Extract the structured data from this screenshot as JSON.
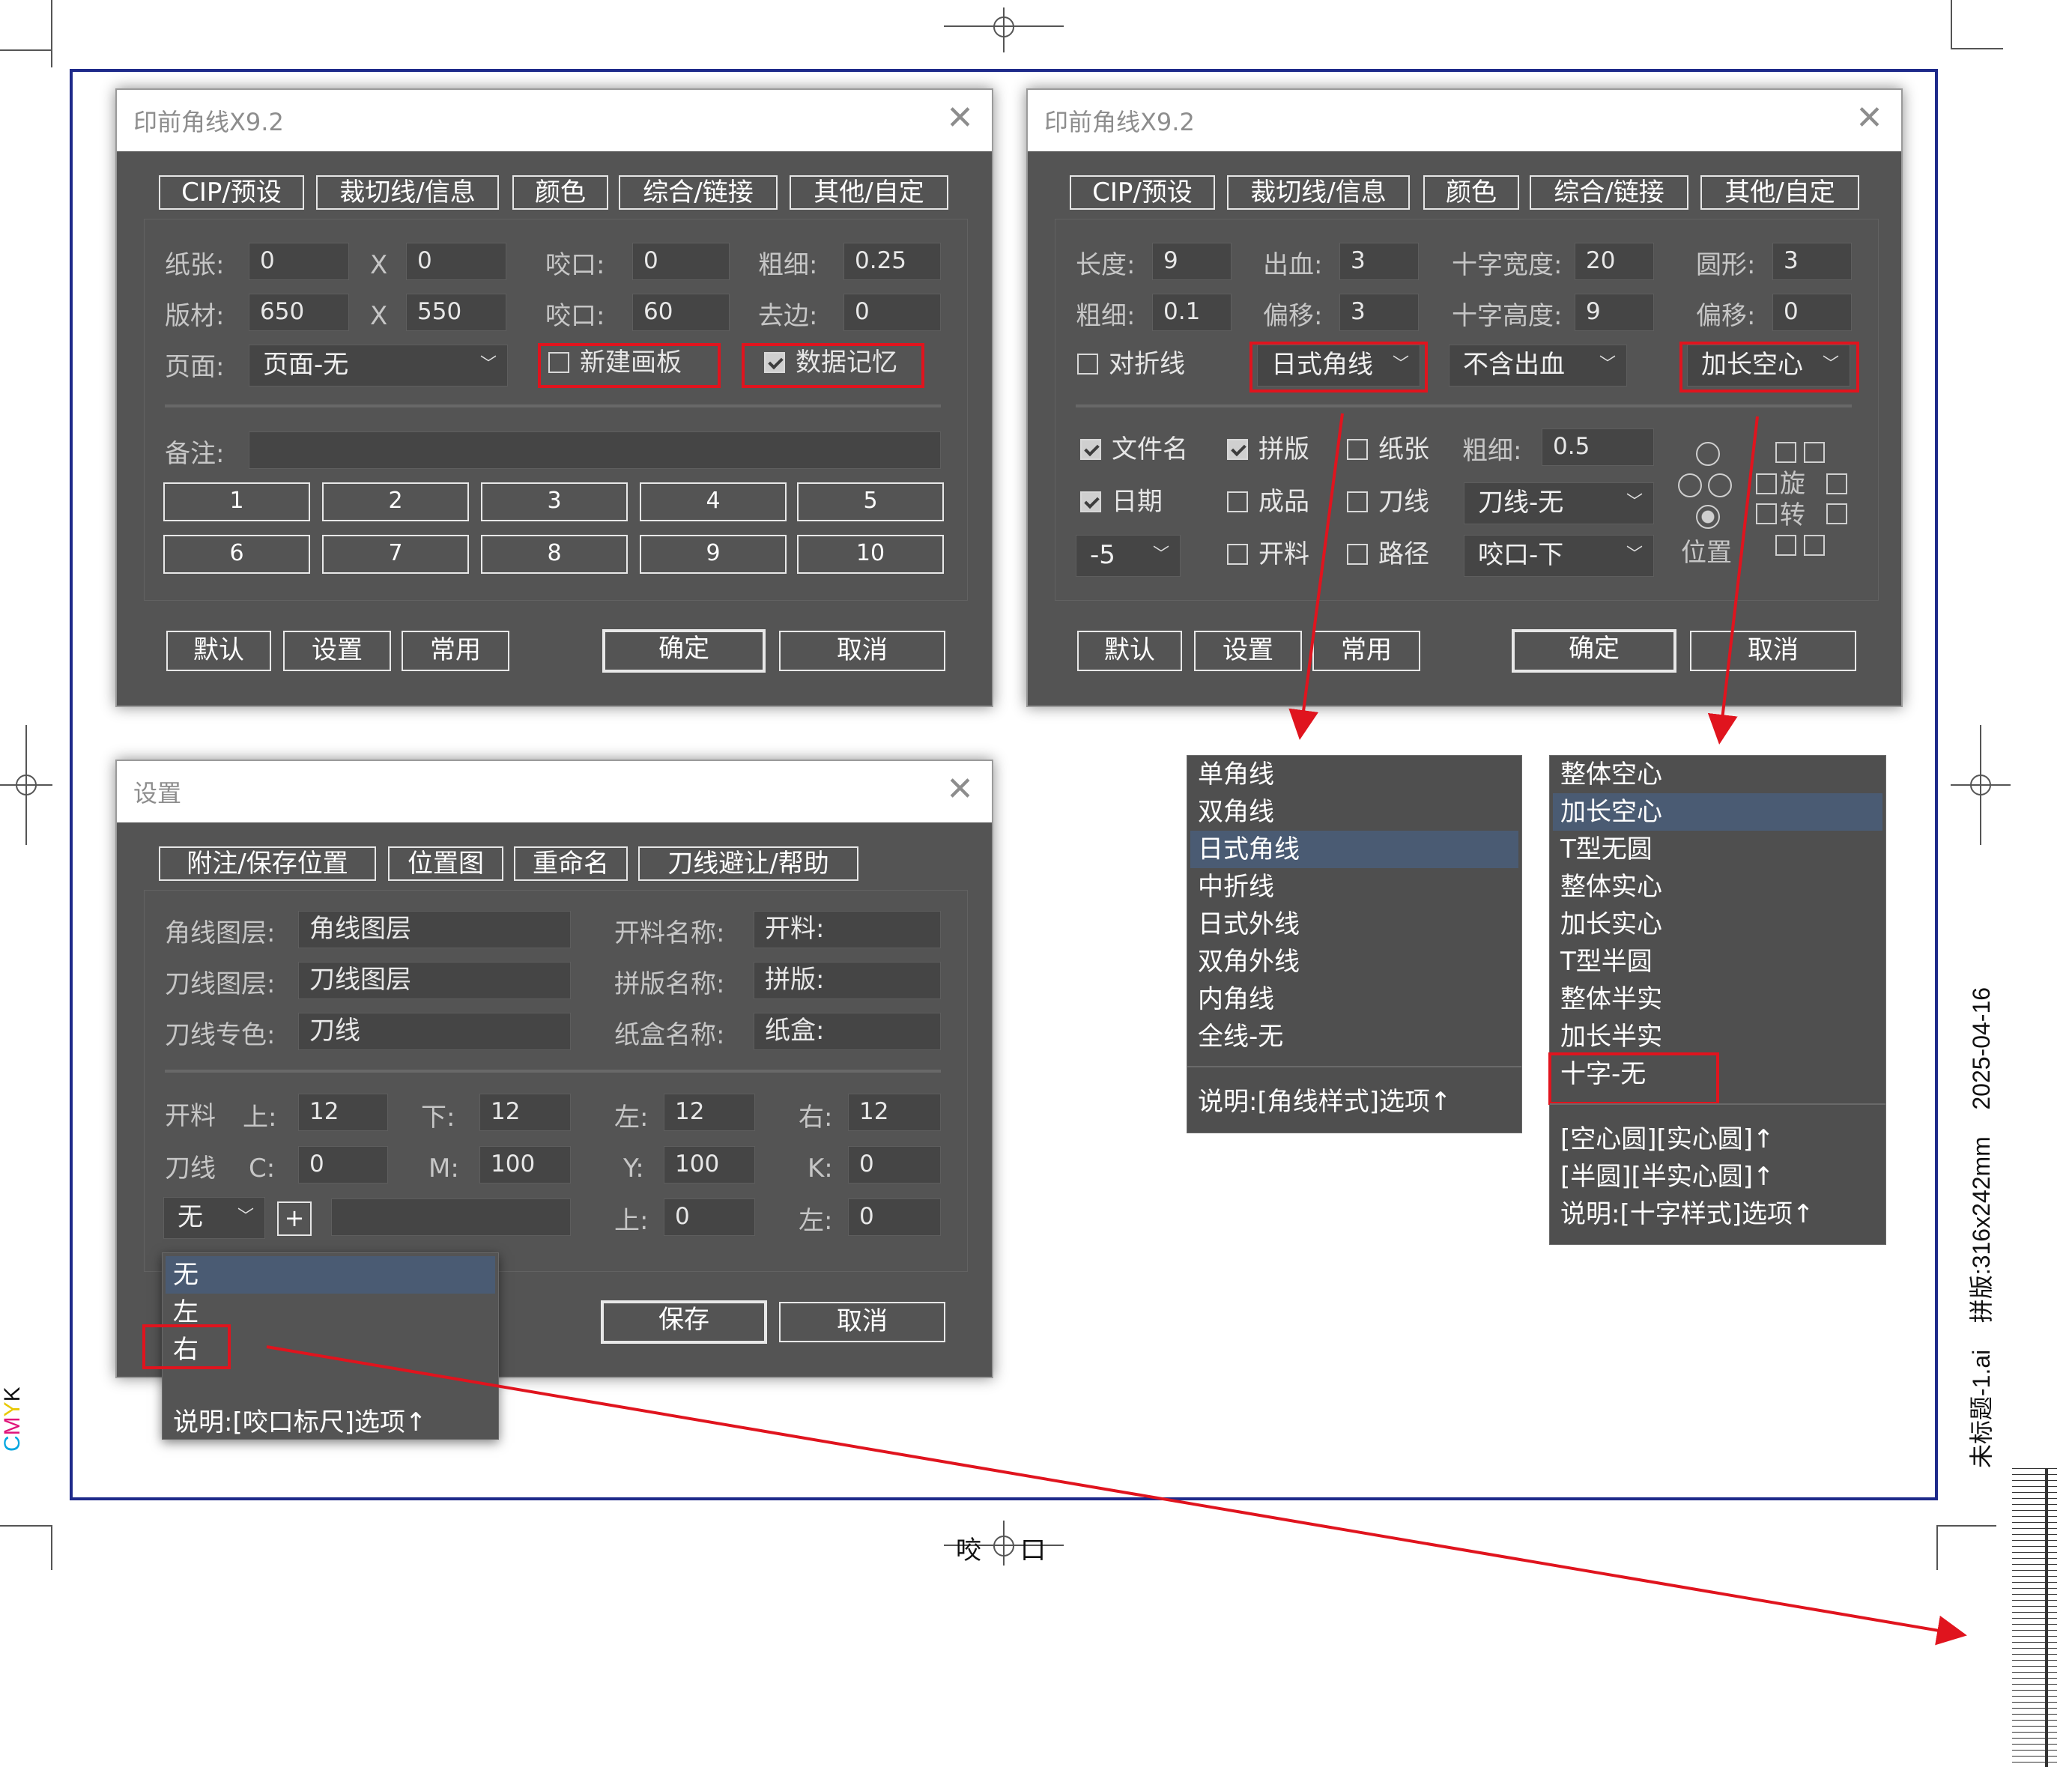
{
  "dialog1": {
    "title": "印前角线X9.2",
    "tabs": [
      "CIP/预设",
      "裁切线/信息",
      "颜色",
      "综合/链接",
      "其他/自定"
    ],
    "paper_label": "纸张:",
    "paper_w": "0",
    "x1": "X",
    "paper_h": "0",
    "bite1_label": "咬口:",
    "bite1_value": "0",
    "thick_label": "粗细:",
    "thick_value": "0.25",
    "plate_label": "版材:",
    "plate_w": "650",
    "x2": "X",
    "plate_h": "550",
    "bite2_label": "咬口:",
    "bite2_value": "60",
    "trim_label": "去边:",
    "trim_value": "0",
    "page_label": "页面:",
    "page_value": "页面-无",
    "new_artboard": "新建画板",
    "data_memory": "数据记忆",
    "notes_label": "备注:",
    "num_buttons": [
      "1",
      "2",
      "3",
      "4",
      "5",
      "6",
      "7",
      "8",
      "9",
      "10"
    ],
    "btn_default": "默认",
    "btn_settings": "设置",
    "btn_common": "常用",
    "btn_ok": "确定",
    "btn_cancel": "取消"
  },
  "dialog2": {
    "title": "印前角线X9.2",
    "tabs": [
      "CIP/预设",
      "裁切线/信息",
      "颜色",
      "综合/链接",
      "其他/自定"
    ],
    "length_label": "长度:",
    "length_value": "9",
    "bleed_label": "出血:",
    "bleed_value": "3",
    "cross_w_label": "十字宽度:",
    "cross_w_value": "20",
    "round_label": "圆形:",
    "round_value": "3",
    "thick_label": "粗细:",
    "thick_value": "0.1",
    "offset_label": "偏移:",
    "offset_value": "3",
    "cross_h_label": "十字高度:",
    "cross_h_value": "9",
    "offset2_label": "偏移:",
    "offset2_value": "0",
    "fold_line": "对折线",
    "corner_style": "日式角线",
    "bleed_mode": "不含出血",
    "cross_style": "加长空心",
    "chk_filename": "文件名",
    "chk_imposition": "拼版",
    "chk_paper": "纸张",
    "thick2_label": "粗细:",
    "thick2_value": "0.5",
    "chk_date": "日期",
    "chk_finished": "成品",
    "chk_knife": "刀线",
    "knife_select": "刀线-无",
    "offset_select": "-5",
    "chk_cut": "开料",
    "chk_path": "路径",
    "bite_select": "咬口-下",
    "rotate_1": "旋",
    "rotate_2": "转",
    "position_label": "位置",
    "btn_default": "默认",
    "btn_settings": "设置",
    "btn_common": "常用",
    "btn_ok": "确定",
    "btn_cancel": "取消"
  },
  "corner_list": {
    "items": [
      "单角线",
      "双角线",
      "日式角线",
      "中折线",
      "日式外线",
      "双角外线",
      "内角线",
      "全线-无"
    ],
    "selected": "日式角线",
    "note": "说明:[角线样式]选项↑"
  },
  "cross_list": {
    "items": [
      "整体空心",
      "加长空心",
      "T型无圆",
      "整体实心",
      "加长实心",
      "T型半圆",
      "整体半实",
      "加长半实",
      "十字-无"
    ],
    "selected": "加长空心",
    "note1": "[空心圆][实心圆]↑",
    "note2": "[半圆][半实心圆]↑",
    "note3": "说明:[十字样式]选项↑"
  },
  "dialog3": {
    "title": "设置",
    "tabs": [
      "附注/保存位置",
      "位置图",
      "重命名",
      "刀线避让/帮助"
    ],
    "corner_layer_label": "角线图层:",
    "corner_layer_value": "角线图层",
    "cut_name_label": "开料名称:",
    "cut_name_value": "开料:",
    "knife_layer_label": "刀线图层:",
    "knife_layer_value": "刀线图层",
    "imposition_name_label": "拼版名称:",
    "imposition_name_value": "拼版:",
    "knife_spot_label": "刀线专色:",
    "knife_spot_value": "刀线",
    "box_name_label": "纸盒名称:",
    "box_name_value": "纸盒:",
    "cut_label": "开料",
    "top_label": "上:",
    "top_value": "12",
    "bottom_label": "下:",
    "bottom_value": "12",
    "left_label": "左:",
    "left_value": "12",
    "right_label": "右:",
    "right_value": "12",
    "knife_label": "刀线",
    "c_label": "C:",
    "c_value": "0",
    "m_label": "M:",
    "m_value": "100",
    "y_label": "Y:",
    "y_value": "100",
    "k_label": "K:",
    "k_value": "0",
    "ruler_select": "无",
    "plus": "+",
    "top2_label": "上:",
    "top2_value": "0",
    "left2_label": "左:",
    "left2_value": "0",
    "btn_save": "保存",
    "btn_cancel": "取消"
  },
  "ruler_list": {
    "items": [
      "无",
      "左",
      "右"
    ],
    "selected": "无",
    "note": "说明:[咬口标尺]选项↑"
  },
  "canvas": {
    "bite_text_1": "咬",
    "bite_text_2": "口",
    "cmyk": [
      "C",
      "M",
      "Y",
      "K"
    ],
    "side_info": "未标题-1.ai    拼版:316x242mm    2025-04-16"
  },
  "colors": {
    "frame_blue": "#1e2a8a",
    "annotation_red": "#e0141e",
    "dialog_bg": "#545454",
    "highlight": "#4a5b73"
  }
}
